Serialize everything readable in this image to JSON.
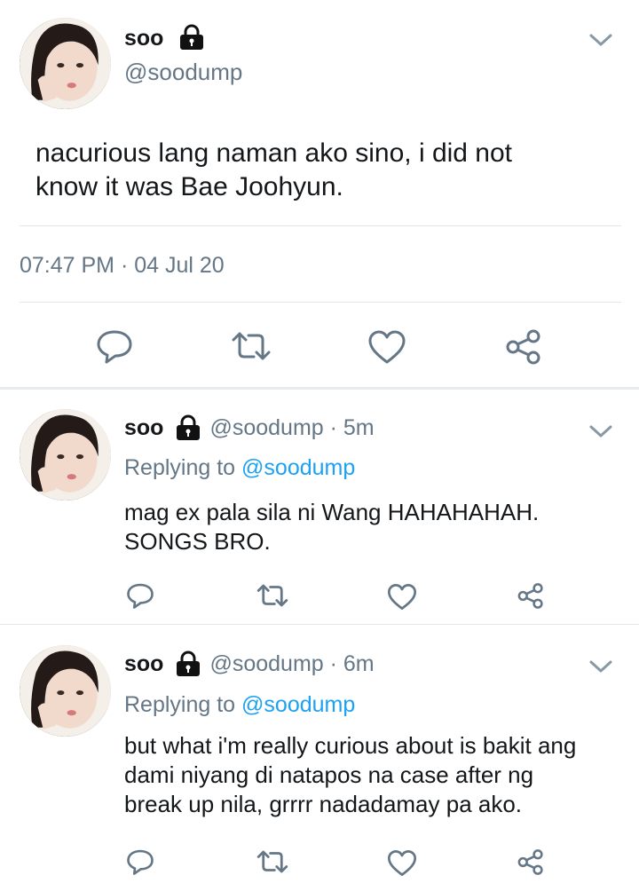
{
  "main_tweet": {
    "display_name": "soo",
    "handle": "@soodump",
    "text_line1": "nacurious lang naman ako sino, i did not",
    "text_line2": "know it was Bae Joohyun.",
    "timestamp": "07:47 PM · 04 Jul 20"
  },
  "replies": [
    {
      "display_name": "soo",
      "handle_time": "@soodump · 5m",
      "replying_prefix": "Replying to ",
      "replying_handle": "@soodump",
      "text_line1": "mag ex pala sila ni Wang HAHAHAHAH.",
      "text_line2": "SONGS BRO.",
      "text_line3": ""
    },
    {
      "display_name": "soo",
      "handle_time": "@soodump · 6m",
      "replying_prefix": "Replying to ",
      "replying_handle": "@soodump",
      "text_line1": "but what i'm really curious about is bakit ang",
      "text_line2": "dami niyang di natapos na case after ng",
      "text_line3": "break up nila, grrrr nadadamay pa ako."
    }
  ],
  "icons": {
    "reply": "reply-icon",
    "retweet": "retweet-icon",
    "like": "heart-icon",
    "share": "share-icon",
    "lock": "lock-icon",
    "more": "chevron-down-icon"
  },
  "colors": {
    "text": "#14171a",
    "secondary": "#657786",
    "link": "#1da1f2",
    "divider": "#e1e8ed"
  }
}
